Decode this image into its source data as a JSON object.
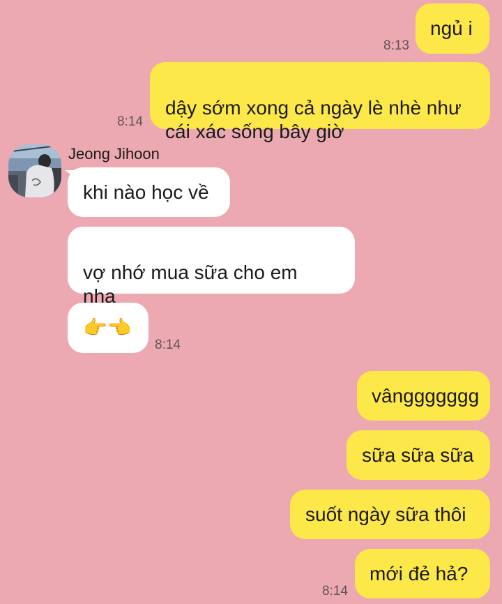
{
  "chat": {
    "contact_name": "Jeong Jihoon",
    "avatar_icon": "profile-photo",
    "colors": {
      "background": "#eca9b1",
      "outgoing_bubble": "#fde84a",
      "incoming_bubble": "#ffffff"
    },
    "messages": [
      {
        "side": "outgoing",
        "text": "ngủ i"
      },
      {
        "side": "outgoing",
        "text": "dậy sớm xong cả ngày lè nhè như\ncái xác sống bây giờ"
      },
      {
        "side": "incoming",
        "text": "khi nào học về"
      },
      {
        "side": "incoming",
        "text": "vợ nhớ mua sữa cho em\nnha"
      },
      {
        "side": "incoming",
        "text": "👉👈",
        "icon": "pointing-fingers-emoji"
      },
      {
        "side": "outgoing",
        "text": "vânggggggg"
      },
      {
        "side": "outgoing",
        "text": "sữa sữa sữa"
      },
      {
        "side": "outgoing",
        "text": "suốt ngày sữa thôi"
      },
      {
        "side": "outgoing",
        "text": "mới đẻ hả?"
      }
    ],
    "timestamps": [
      "8:13",
      "8:14",
      "8:14",
      "8:14"
    ]
  }
}
